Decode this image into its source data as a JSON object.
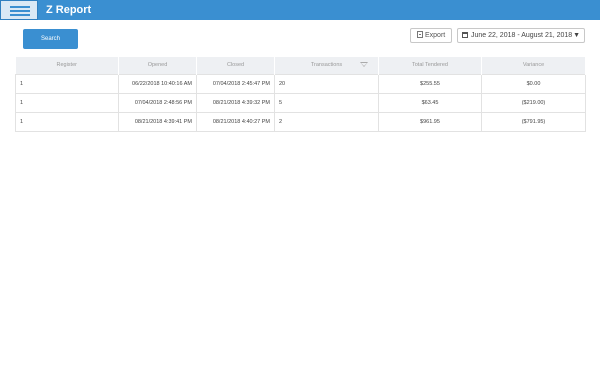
{
  "header": {
    "title": "Z Report"
  },
  "toolbar": {
    "search_label": "Search",
    "export_label": "Export",
    "date_range": "June 22, 2018 - August 21, 2018"
  },
  "table": {
    "columns": [
      "Register",
      "Opened",
      "Closed",
      "Transactions",
      "Total Tendered",
      "Variance"
    ],
    "rows": [
      [
        "1",
        "06/22/2018 10:40:16 AM",
        "07/04/2018 2:45:47 PM",
        "20",
        "$255.55",
        "$0.00"
      ],
      [
        "1",
        "07/04/2018 2:48:56 PM",
        "08/21/2018 4:39:32 PM",
        "5",
        "$63.45",
        "($219.00)"
      ],
      [
        "1",
        "08/21/2018 4:39:41 PM",
        "08/21/2018 4:40:27 PM",
        "2",
        "$961.95",
        "($791.95)"
      ]
    ]
  },
  "colors": {
    "accent": "#3a8fd1",
    "header_bg": "#eef0f3"
  },
  "icons": {
    "menu": "hamburger-icon",
    "export": "document-icon",
    "date": "calendar-icon",
    "dropdown": "chevron-down-icon",
    "filter": "filter-icon"
  }
}
